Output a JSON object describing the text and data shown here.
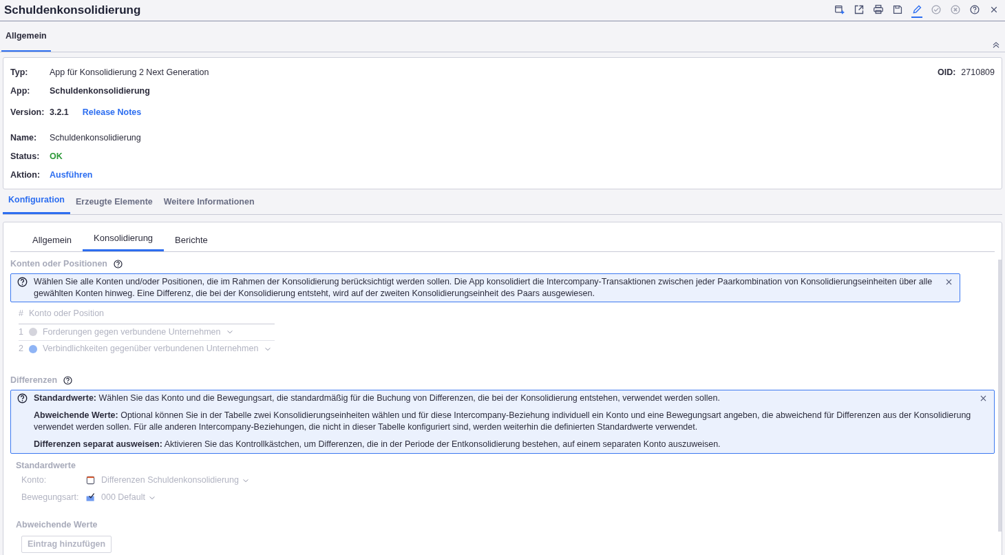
{
  "window": {
    "title": "Schuldenkonsolidierung"
  },
  "toolbar": [
    {
      "kind": "calendar-add",
      "disabled": false,
      "selected": false
    },
    {
      "kind": "external",
      "disabled": false,
      "selected": false
    },
    {
      "kind": "print",
      "disabled": false,
      "selected": false
    },
    {
      "kind": "save",
      "disabled": false,
      "selected": false
    },
    {
      "kind": "edit",
      "disabled": false,
      "selected": true
    },
    {
      "kind": "check",
      "disabled": true,
      "selected": false
    },
    {
      "kind": "cancel",
      "disabled": true,
      "selected": false
    },
    {
      "kind": "help",
      "disabled": false,
      "selected": false
    },
    {
      "kind": "close",
      "disabled": false,
      "selected": false
    }
  ],
  "top_tabs": [
    {
      "label": "Allgemein",
      "selected": true
    }
  ],
  "info": {
    "fields": [
      {
        "label": "Typ:",
        "value": "App für Konsolidierung 2 Next Generation",
        "kind": "text"
      },
      {
        "label": "App:",
        "value": "Schuldenkonsolidierung",
        "kind": "bold"
      },
      {
        "label": "Version:",
        "value": "3.2.1",
        "kind": "version",
        "link": "Release Notes"
      },
      {
        "label": "Name:",
        "value": "Schuldenkonsolidierung",
        "kind": "text"
      },
      {
        "label": "Status:",
        "value": "OK",
        "kind": "ok"
      },
      {
        "label": "Aktion:",
        "value": "Ausführen",
        "kind": "link"
      }
    ],
    "oid": {
      "label": "OID:",
      "value": "2710809"
    }
  },
  "section_tabs": [
    {
      "label": "Konfiguration",
      "selected": true
    },
    {
      "label": "Erzeugte Elemente",
      "selected": false
    },
    {
      "label": "Weitere Informationen",
      "selected": false
    }
  ],
  "sub_tabs": [
    {
      "label": "Allgemein",
      "selected": false
    },
    {
      "label": "Konsolidierung",
      "selected": true
    },
    {
      "label": "Berichte",
      "selected": false
    }
  ],
  "konten": {
    "title": "Konten oder Positionen",
    "help": [
      "Wählen Sie alle Konten und/oder Positionen, die im Rahmen der Konsolidierung berücksichtigt werden sollen. Die App konsolidiert die Intercompany-Transaktionen zwischen jeder Paarkombination von Konsolidierungseinheiten über alle gewählten Konten hinweg. Eine Differenz, die bei der Konsolidierung entsteht, wird auf der zweiten Konsolidierungseinheit des Paars ausgewiesen."
    ],
    "columns": [
      "#",
      "Konto oder Position"
    ],
    "rows": [
      {
        "number": "1",
        "color": "#d4d4dc",
        "label": "Forderungen gegen verbundene Unternehmen"
      },
      {
        "number": "2",
        "color": "#8fb4f5",
        "label": "Verbindlichkeiten gegenüber verbundenen Unternehmen"
      }
    ]
  },
  "differenzen": {
    "title": "Differenzen",
    "help": [
      "**Standardwerte:** Wählen Sie das Konto und die Bewegungsart, die standardmäßig für die Buchung von Differenzen, die bei der Konsolidierung entstehen, verwendet werden sollen.",
      "**Abweichende Werte:** Optional können Sie in der Tabelle zwei Konsolidierungseinheiten wählen und für diese Intercompany-Beziehung individuell ein Konto und eine Bewegungsart angeben, die abweichend für Differenzen aus der Konsolidierung verwendet werden sollen. Für alle anderen Intercompany-Beziehungen, die nicht in dieser Tabelle konfiguriert sind, werden weiterhin die definierten Standardwerte verwendet.",
      "**Differenzen separat ausweisen:** Aktivieren Sie das Kontrollkästchen, um Differenzen, die in der Periode der Entkonsolidierung bestehen, auf einem separaten Konto auszuweisen."
    ],
    "standard_title": "Standardwerte",
    "fields": [
      {
        "label": "Konto:",
        "value": "Differenzen Schuldenkonsolidierung",
        "kind": "account"
      },
      {
        "label": "Bewegungsart:",
        "value": "000 Default",
        "kind": "movement"
      }
    ],
    "deviating_title": "Abweichende Werte",
    "add_button": "Eintrag hinzufügen"
  }
}
